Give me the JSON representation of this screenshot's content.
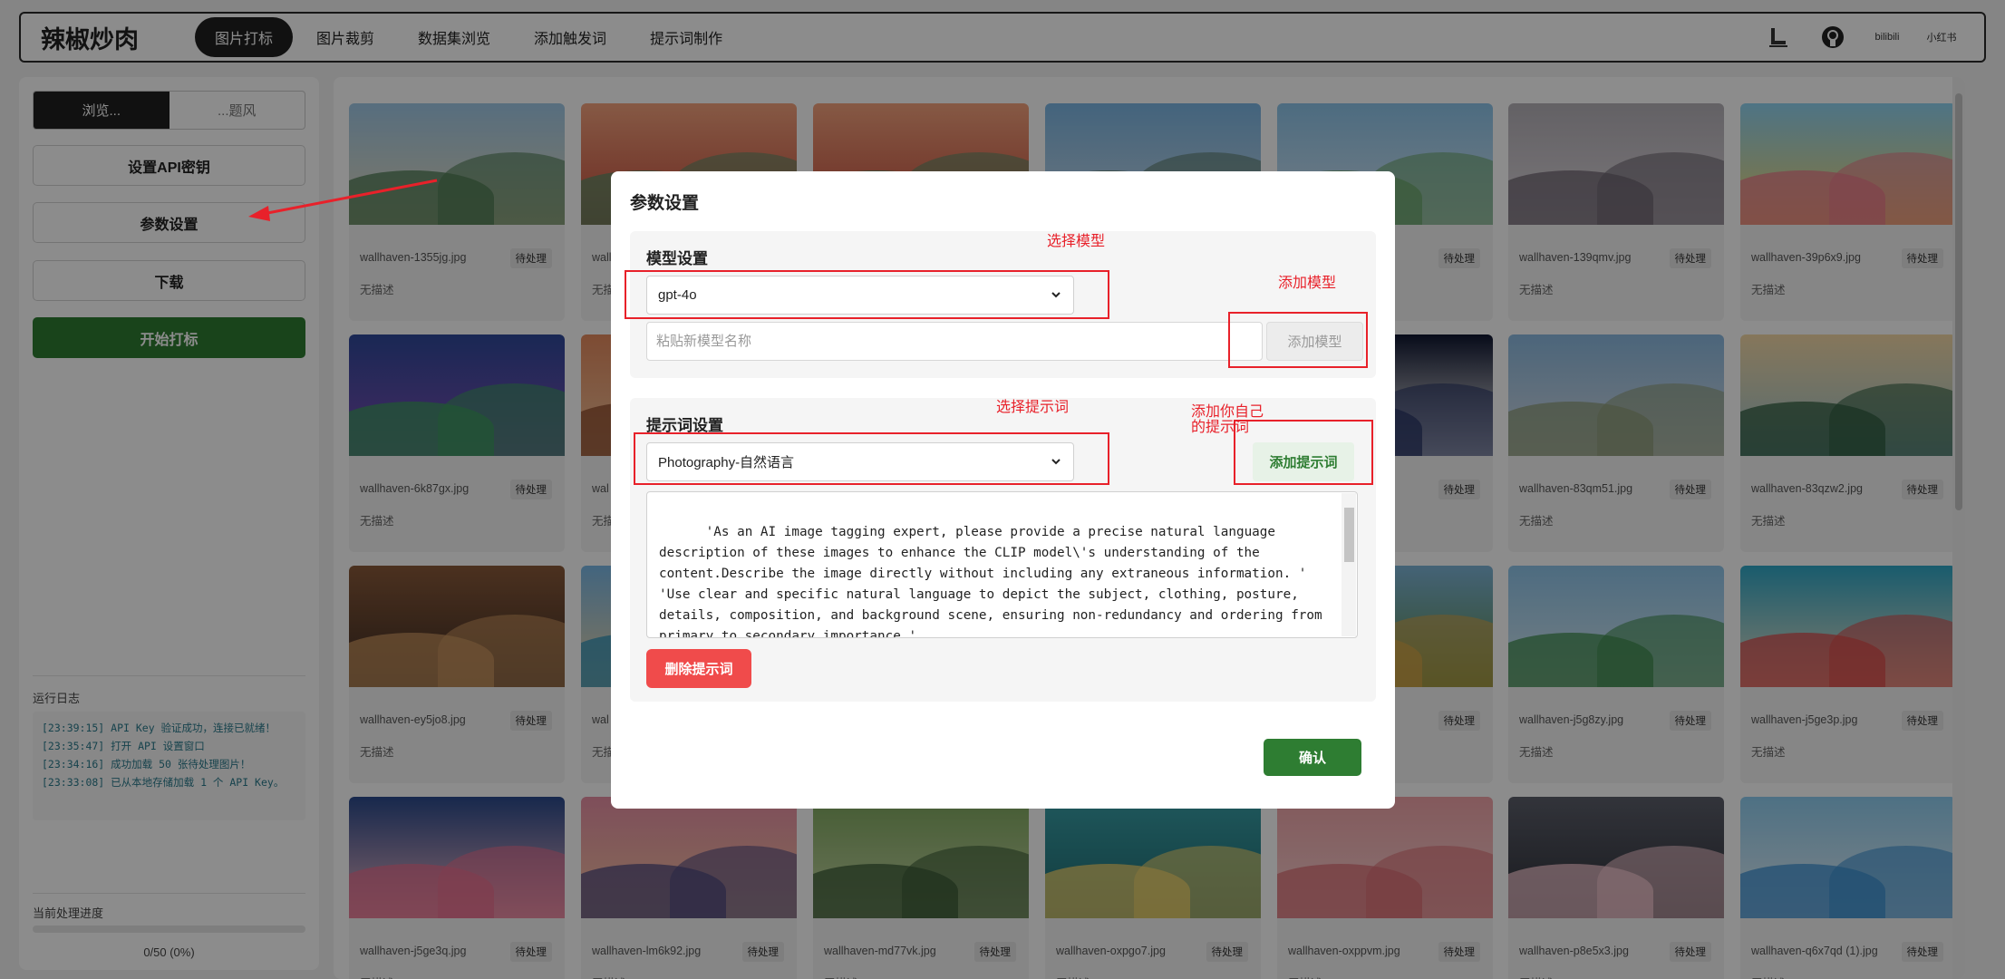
{
  "header": {
    "brand": "辣椒炒肉",
    "tabs": [
      {
        "label": "图片打标",
        "active": true
      },
      {
        "label": "图片裁剪",
        "active": false
      },
      {
        "label": "数据集浏览",
        "active": false
      },
      {
        "label": "添加触发词",
        "active": false
      },
      {
        "label": "提示词制作",
        "active": false
      }
    ],
    "icons": [
      "lora-boot-icon",
      "github-icon",
      "bilibili-icon",
      "xiaohongshu-icon"
    ],
    "icon_texts": {
      "bilibili": "bilibili",
      "xiaohongshu": "小红书"
    }
  },
  "sidebar": {
    "toggle": {
      "left": "浏览...",
      "right": "...题风"
    },
    "buttons": {
      "api_key": "设置API密钥",
      "params": "参数设置",
      "download": "下载",
      "start": "开始打标"
    },
    "log_title": "运行日志",
    "logs": [
      "[23:39:15] API Key 验证成功，连接已就绪！",
      "[23:35:47] 打开 API 设置窗口",
      "[23:34:16] 成功加载 50 张待处理图片！",
      "[23:33:08] 已从本地存储加载 1 个 API Key。"
    ],
    "progress_title": "当前处理进度",
    "progress_text": "0/50 (0%)",
    "progress_fraction": 0
  },
  "gallery": {
    "status_label": "待处理",
    "empty_desc": "无描述",
    "rows": [
      [
        {
          "file": "wallhaven-1355jg.jpg",
          "colors": [
            "#9fc8e6",
            "#4c7a52",
            "#e9dfc0"
          ]
        },
        {
          "file": "wall",
          "colors": [
            "#f4a37e",
            "#5b8b67",
            "#c34a3a"
          ]
        },
        {
          "file": "",
          "colors": [
            "#f4a37e",
            "#5b8b67",
            "#c34a3a"
          ]
        },
        {
          "file": "",
          "colors": [
            "#7bb6e3",
            "#5c7a6a",
            "#c7d8e6"
          ]
        },
        {
          "file": "g",
          "colors": [
            "#8cc4ea",
            "#6aa36a",
            "#d6e6f2"
          ]
        },
        {
          "file": "wallhaven-139qmv.jpg",
          "colors": [
            "#b5b1b8",
            "#6d6470",
            "#dfd9de"
          ]
        },
        {
          "file": "wallhaven-39p6x9.jpg",
          "colors": [
            "#8fd3f2",
            "#e97b8a",
            "#f5d96b"
          ]
        }
      ],
      [
        {
          "file": "wallhaven-6k87gx.jpg",
          "colors": [
            "#2f4a9a",
            "#3c9b5e",
            "#7f4cb5"
          ]
        },
        {
          "file": "wal",
          "colors": [
            "#e48a5e",
            "#8b4a2b",
            "#f2c49c"
          ]
        },
        {
          "file": "",
          "colors": [
            "#dcdcdc",
            "#cfcfcf",
            "#bdbdbd"
          ]
        },
        {
          "file": "",
          "colors": [
            "#dcdcdc",
            "#cfcfcf",
            "#bdbdbd"
          ]
        },
        {
          "file": "",
          "colors": [
            "#0f1630",
            "#2a3566",
            "#ffffff"
          ]
        },
        {
          "file": "wallhaven-83qm51.jpg",
          "colors": [
            "#8ab9e0",
            "#8e9b7a",
            "#d7dce4"
          ]
        },
        {
          "file": "wallhaven-83qzw2.jpg",
          "colors": [
            "#f4d9a6",
            "#2f5b3f",
            "#9cc4cf"
          ]
        }
      ],
      [
        {
          "file": "wallhaven-ey5jo8.jpg",
          "colors": [
            "#8a5a3a",
            "#c9955f",
            "#3a2a22"
          ]
        },
        {
          "file": "wal",
          "colors": [
            "#79b8e6",
            "#2e8fb5",
            "#f0d7a8"
          ]
        },
        {
          "file": "",
          "colors": [
            "#dcdcdc",
            "#cfcfcf",
            "#bdbdbd"
          ]
        },
        {
          "file": "",
          "colors": [
            "#dcdcdc",
            "#cfcfcf",
            "#bdbdbd"
          ]
        },
        {
          "file": "",
          "colors": [
            "#7db4d8",
            "#d2a447",
            "#5a8a3f"
          ]
        },
        {
          "file": "wallhaven-j5g8zy.jpg",
          "colors": [
            "#8dc4ea",
            "#3f8a4d",
            "#d8e9f0"
          ]
        },
        {
          "file": "wallhaven-j5ge3p.jpg",
          "colors": [
            "#2fa7c7",
            "#d84b4b",
            "#f2e4c6"
          ]
        }
      ],
      [
        {
          "file": "wallhaven-j5ge3q.jpg",
          "colors": [
            "#2b4a8c",
            "#e76f8f",
            "#f2b9c4"
          ]
        },
        {
          "file": "wallhaven-lm6k92.jpg",
          "colors": [
            "#e78fa5",
            "#4f4a7e",
            "#f5c7a0"
          ]
        },
        {
          "file": "wallhaven-md77vk.jpg",
          "colors": [
            "#7ea85e",
            "#3a5a35",
            "#c9d8a8"
          ]
        },
        {
          "file": "wallhaven-oxpgo7.jpg",
          "colors": [
            "#3aa0a8",
            "#f2d36b",
            "#1e6a70"
          ]
        },
        {
          "file": "wallhaven-oxppvm.jpg",
          "colors": [
            "#f0a3a8",
            "#d96e74",
            "#f7d4d2"
          ]
        },
        {
          "file": "wallhaven-p8e5x3.jpg",
          "colors": [
            "#5c5f6b",
            "#f3c6cf",
            "#2c2e36"
          ]
        },
        {
          "file": "wallhaven-q6x7qd (1).jpg",
          "colors": [
            "#8ecdf0",
            "#3b8fd0",
            "#e8f2f8"
          ]
        }
      ]
    ]
  },
  "modal": {
    "title": "参数设置",
    "model_section": {
      "title": "模型设置",
      "selected": "gpt-4o",
      "new_model_placeholder": "粘贴新模型名称",
      "add_button": "添加模型"
    },
    "prompt_section": {
      "title": "提示词设置",
      "selected": "Photography-自然语言",
      "add_button": "添加提示词",
      "prompt_text": "'As an AI image tagging expert, please provide a precise natural language description of these images to enhance the CLIP model\\'s understanding of the content.Describe the image directly without including any extraneous information. '\n'Use clear and specific natural language to depict the subject, clothing, posture, details, composition, and background scene, ensuring non-redundancy and ordering from primary to secondary importance.'\n'These descriptions will be used for image re-creation, so the closer the resemblance to",
      "delete_button": "删除提示词"
    },
    "confirm_button": "确认"
  },
  "annotations": {
    "select_model": "选择模型",
    "add_model": "添加模型",
    "select_prompt": "选择提示词",
    "add_own_prompt_line1": "添加你自己",
    "add_own_prompt_line2": "的提示词",
    "color": "#e8212a"
  }
}
